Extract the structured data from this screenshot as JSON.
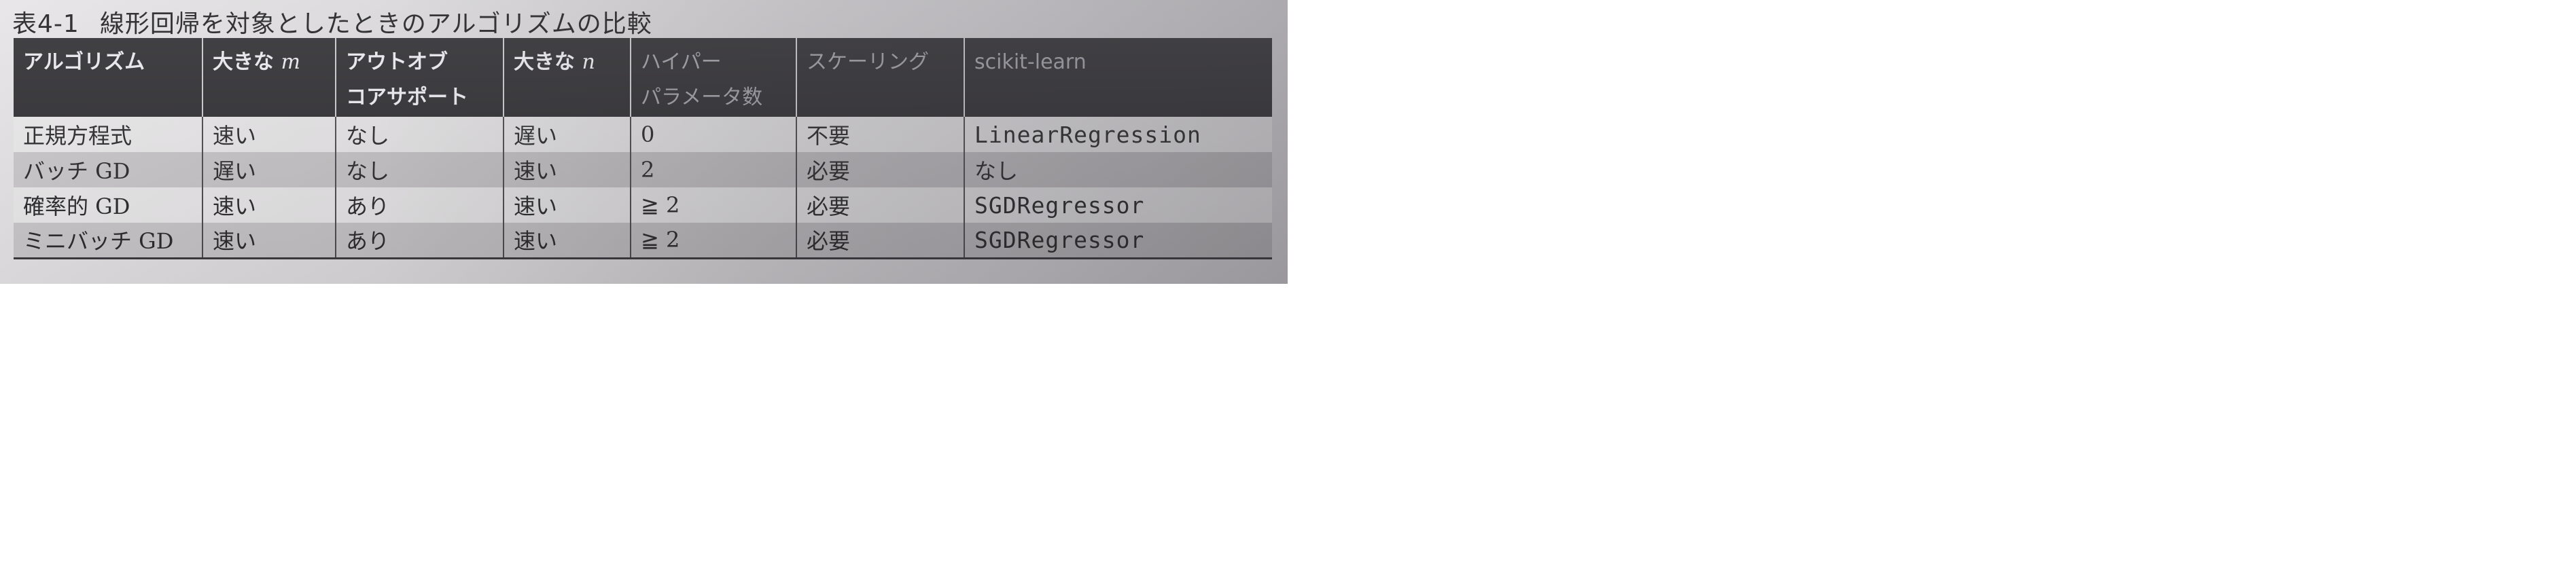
{
  "caption": {
    "number": "表4-1",
    "title": "線形回帰を対象としたときのアルゴリズムの比較"
  },
  "table": {
    "headers": [
      {
        "line1": "アルゴリズム",
        "line2": ""
      },
      {
        "line1": "大きな ",
        "var": "m",
        "line2": ""
      },
      {
        "line1": "アウトオブ",
        "line2": "コアサポート"
      },
      {
        "line1": "大きな ",
        "var": "n",
        "line2": ""
      },
      {
        "line1": "ハイパー",
        "line2": "パラメータ数"
      },
      {
        "line1": "スケーリング",
        "line2": ""
      },
      {
        "line1": "scikit-learn",
        "line2": ""
      }
    ],
    "rows": [
      [
        "正規方程式",
        "速い",
        "なし",
        "遅い",
        "0",
        "不要",
        "LinearRegression"
      ],
      [
        "バッチ GD",
        "遅い",
        "なし",
        "速い",
        "2",
        "必要",
        "なし"
      ],
      [
        "確率的 GD",
        "速い",
        "あり",
        "速い",
        "≧ 2",
        "必要",
        "SGDRegressor"
      ],
      [
        "ミニバッチ GD",
        "速い",
        "あり",
        "速い",
        "≧ 2",
        "必要",
        "SGDRegressor"
      ]
    ]
  }
}
